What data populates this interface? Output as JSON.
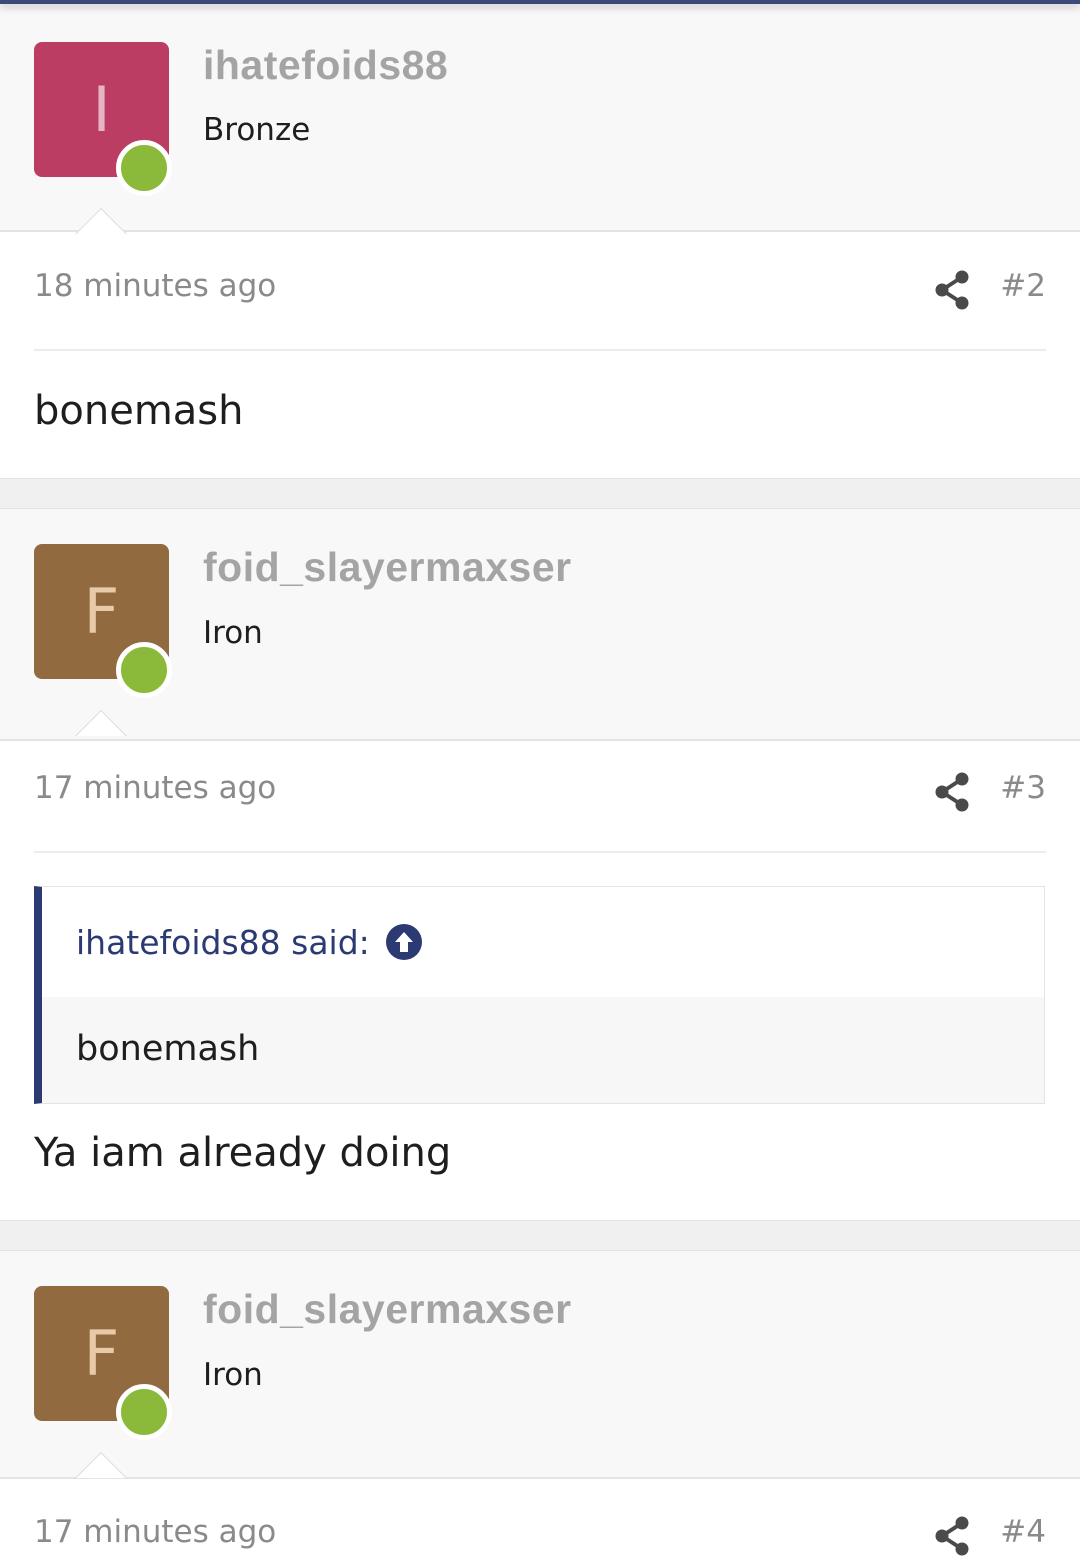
{
  "posts": [
    {
      "avatar_letter": "I",
      "avatar_color": "#bb3d63",
      "username": "ihatefoids88",
      "rank": "Bronze",
      "timestamp": "18 minutes ago",
      "post_number": "#2",
      "message": "bonemash"
    },
    {
      "avatar_letter": "F",
      "avatar_color": "#916a3f",
      "username": "foid_slayermaxser",
      "rank": "Iron",
      "timestamp": "17 minutes ago",
      "post_number": "#3",
      "quote": {
        "author_label": "ihatefoids88 said:",
        "text": "bonemash",
        "icon": "arrow-up-circle-icon"
      },
      "message": "Ya iam already doing"
    },
    {
      "avatar_letter": "F",
      "avatar_color": "#916a3f",
      "username": "foid_slayermaxser",
      "rank": "Iron",
      "timestamp": "17 minutes ago",
      "post_number": "#4"
    }
  ],
  "icons": {
    "share": "share-icon",
    "online": "online-status-icon"
  },
  "colors": {
    "online": "#8bba3b",
    "quote_accent": "#2c3a73"
  }
}
